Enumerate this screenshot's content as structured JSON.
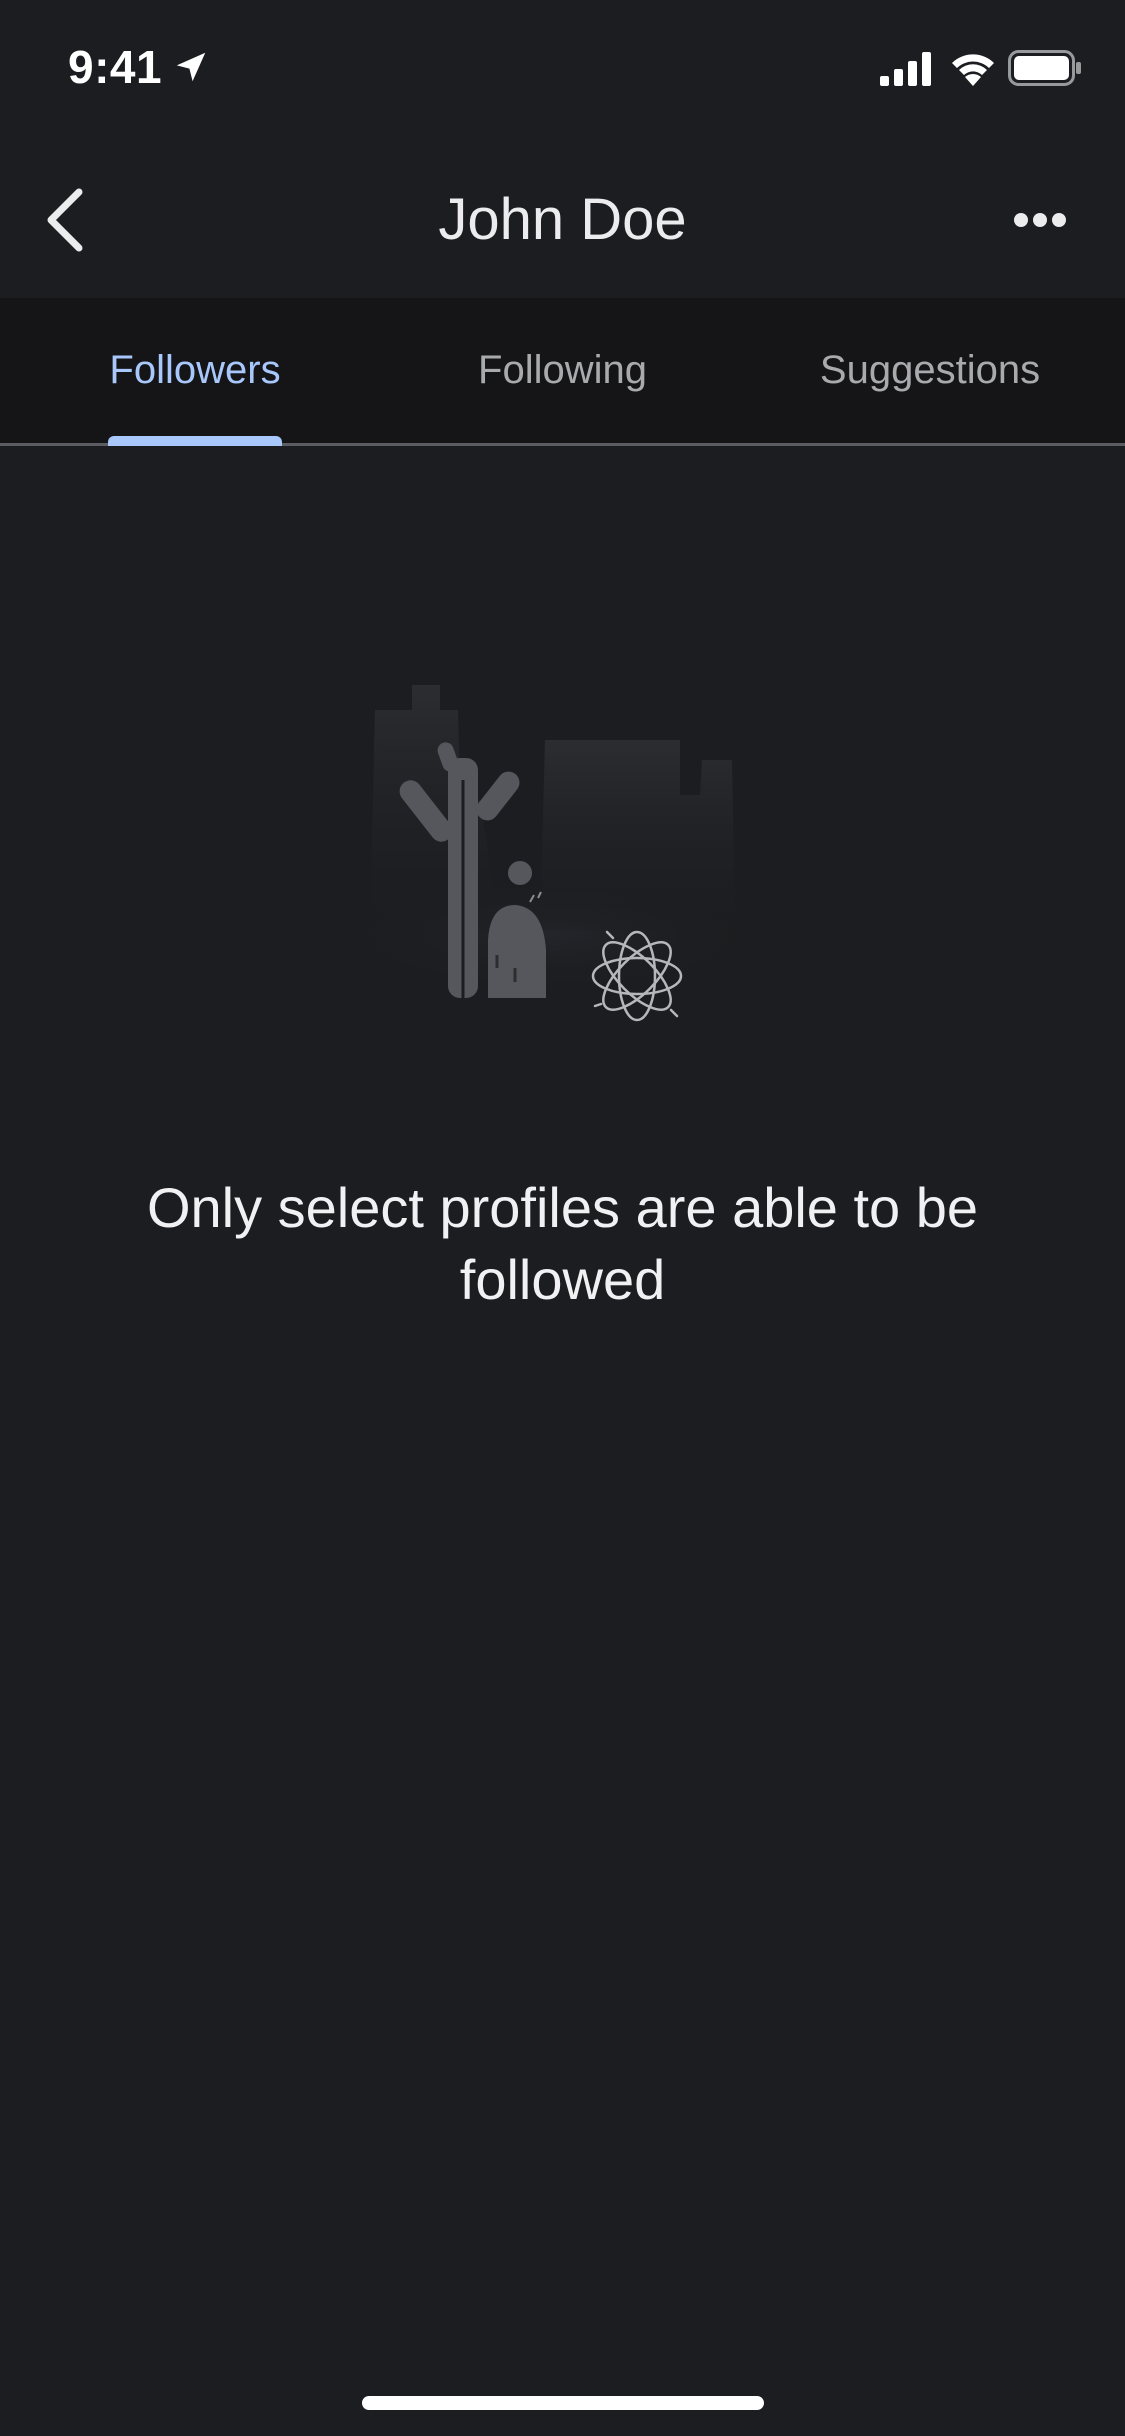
{
  "status_bar": {
    "time": "9:41"
  },
  "header": {
    "title": "John Doe"
  },
  "tabs": [
    {
      "label": "Followers",
      "selected": true
    },
    {
      "label": "Following",
      "selected": false
    },
    {
      "label": "Suggestions",
      "selected": false
    }
  ],
  "empty_state": {
    "message": "Only select profiles are able to be followed"
  },
  "colors": {
    "background": "#1c1d20",
    "tab_bar": "#151518",
    "accent": "#a8c7fa"
  },
  "icons": [
    "location-arrow-icon",
    "signal-icon",
    "wifi-icon",
    "battery-icon",
    "back-arrow-icon",
    "more-options-icon"
  ]
}
